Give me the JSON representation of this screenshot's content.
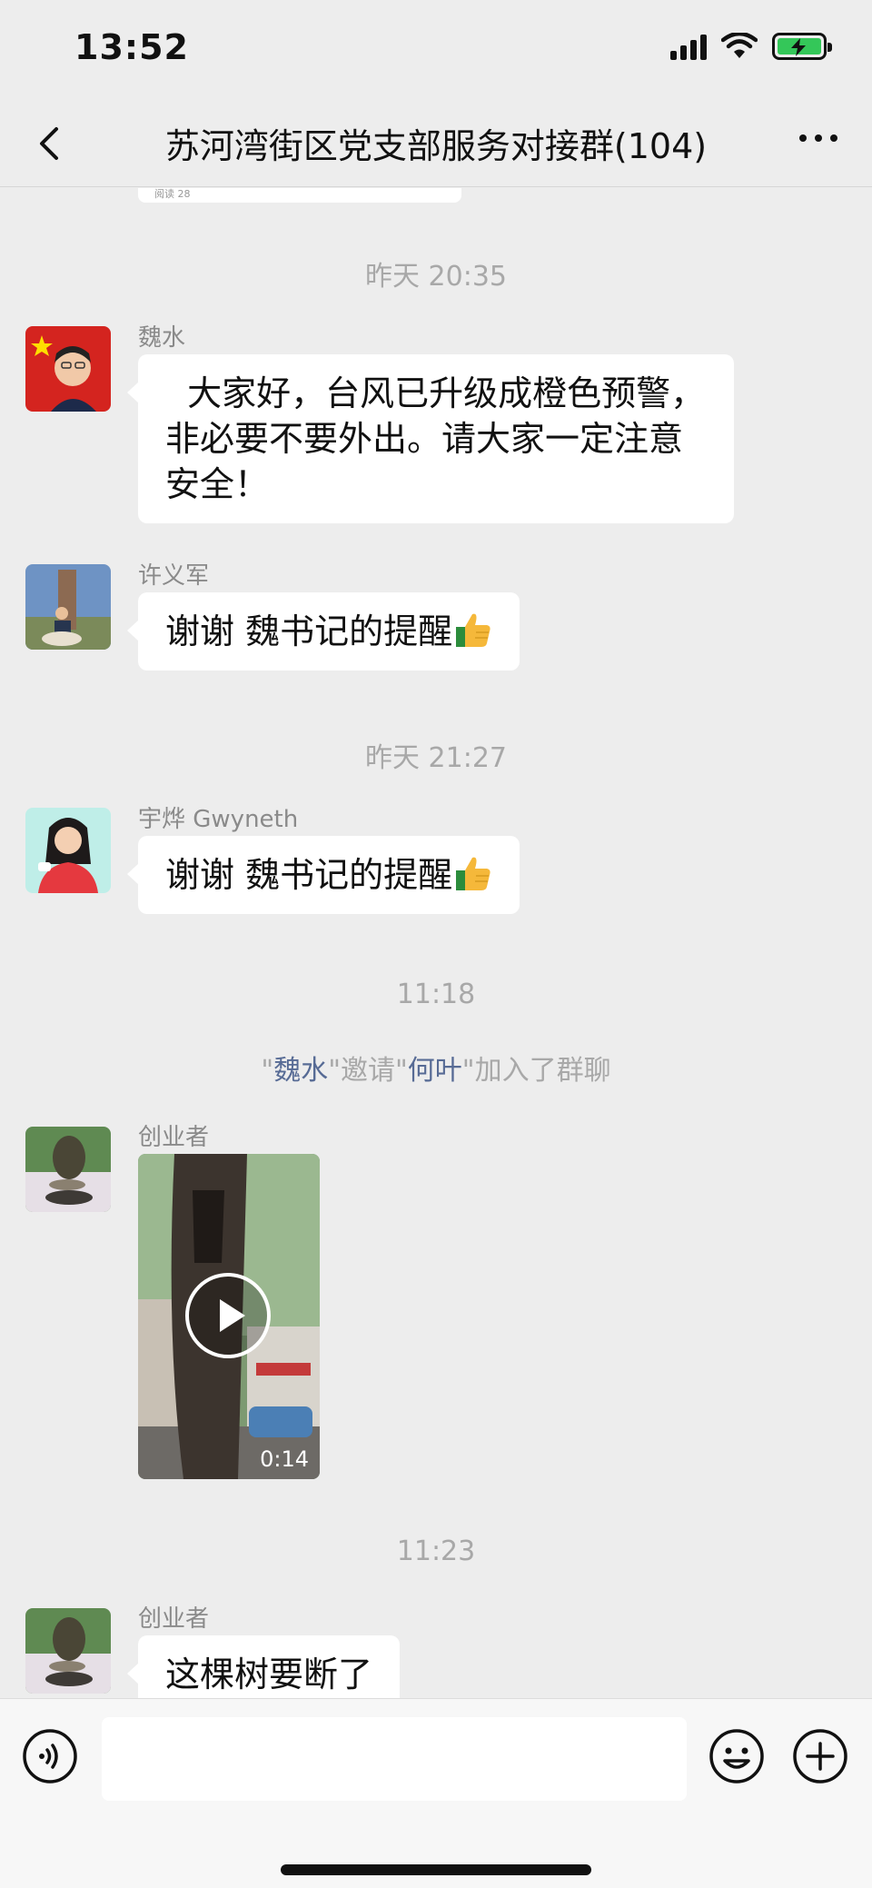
{
  "status": {
    "time": "13:52"
  },
  "header": {
    "title": "苏河湾街区党支部服务对接群(104)"
  },
  "previous_card": {
    "text": "阅读 28"
  },
  "messages": [
    {
      "type": "time",
      "text": "昨天 20:35"
    },
    {
      "type": "text",
      "sender": "魏水",
      "text": "  大家好，台风已升级成橙色预警，非必要不要外出。请大家一定注意安全！"
    },
    {
      "type": "text",
      "sender": "许义军",
      "text": "谢谢 魏书记的提醒"
    },
    {
      "type": "time",
      "text": "昨天 21:27"
    },
    {
      "type": "text",
      "sender": "宇烨 Gwyneth",
      "text": "谢谢 魏书记的提醒"
    },
    {
      "type": "time",
      "text": "11:18"
    },
    {
      "type": "system",
      "parts": [
        "\"",
        "魏水",
        "\"邀请\"",
        "何叶",
        "\"加入了群聊"
      ]
    },
    {
      "type": "video",
      "sender": "创业者",
      "duration": "0:14"
    },
    {
      "type": "time",
      "text": "11:23"
    },
    {
      "type": "text",
      "sender": "创业者",
      "text": "这棵树要断了"
    }
  ],
  "input": {
    "placeholder": ""
  },
  "icons": {
    "back": "chevron-left-icon",
    "more": "more-dots-icon",
    "voice": "voice-icon",
    "emoji": "emoji-icon",
    "plus": "plus-icon",
    "thumbs_up": "thumbs-up-icon"
  },
  "colors": {
    "background": "#ededed",
    "bubble": "#ffffff",
    "system_name": "#576b95",
    "time_text": "#a8a8a8"
  }
}
